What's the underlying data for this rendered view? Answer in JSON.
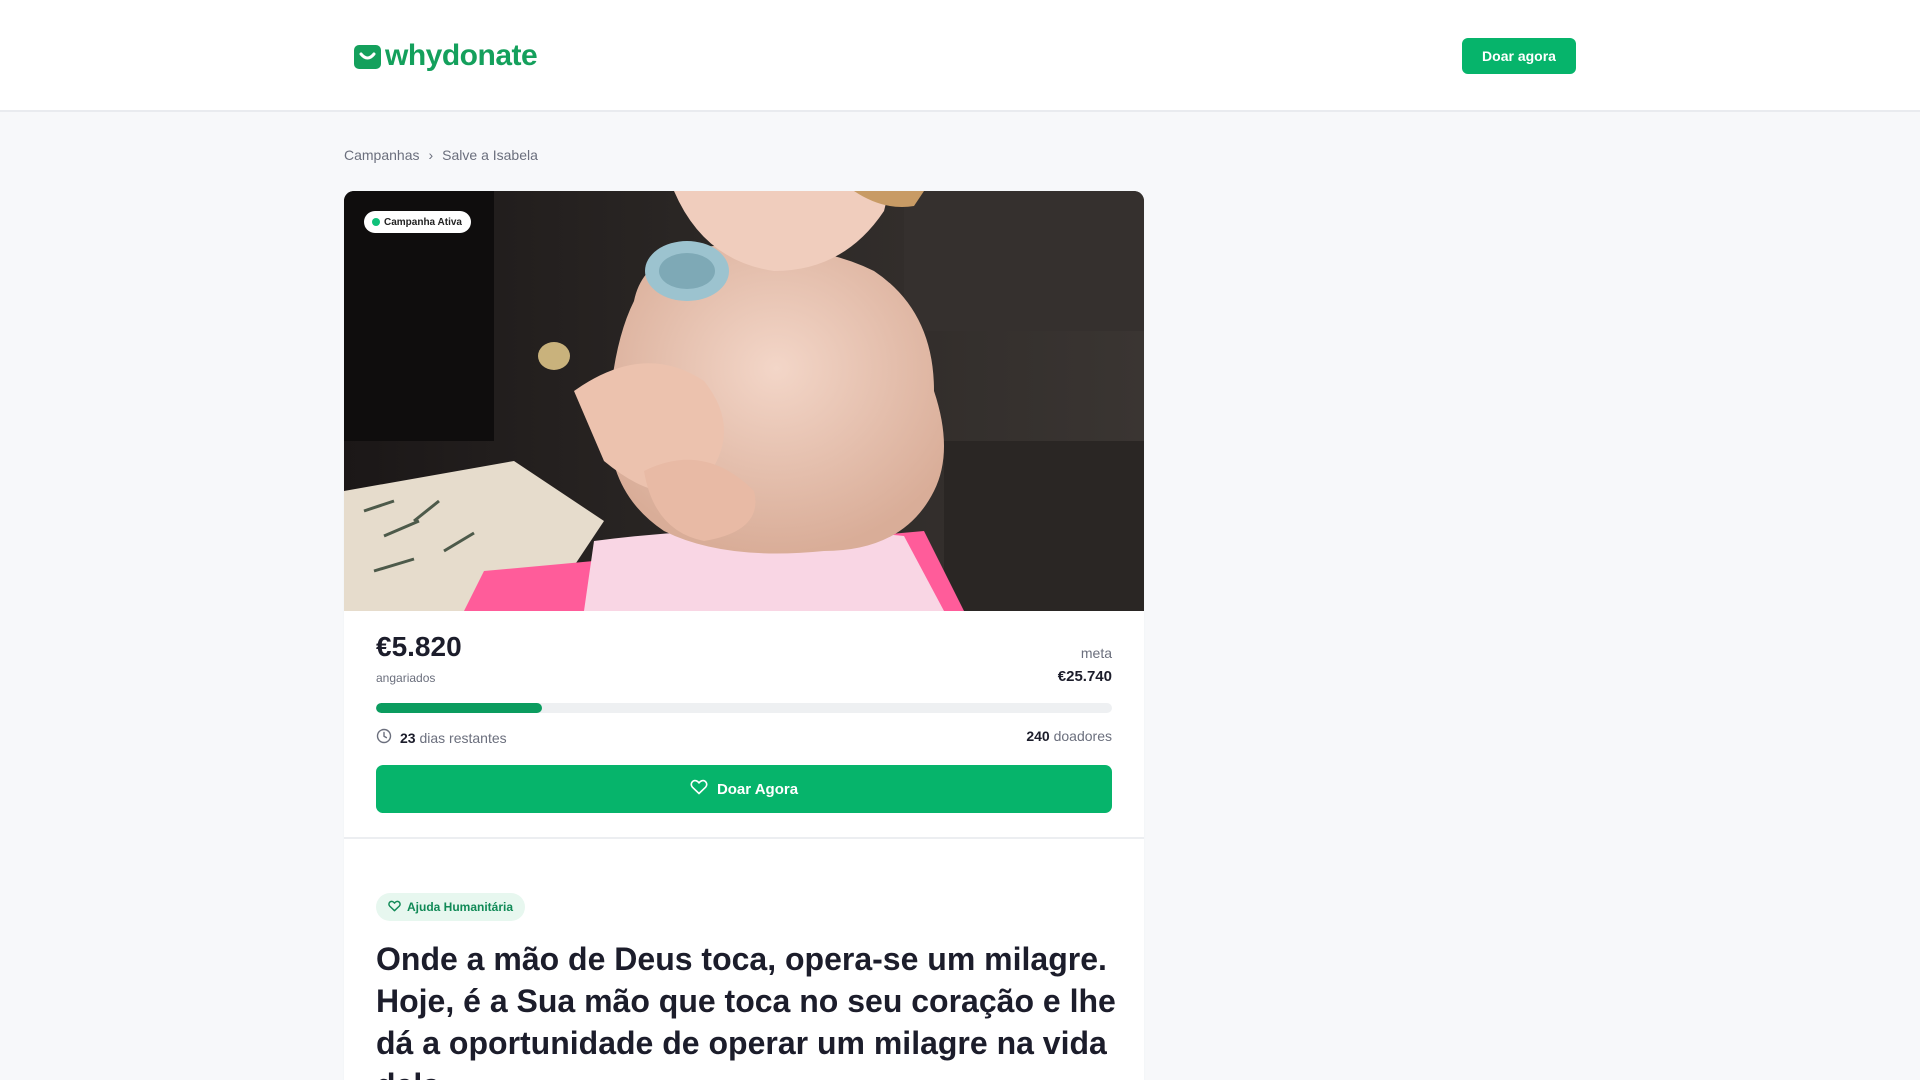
{
  "header": {
    "logo_text": "whydonate",
    "donate_button": "Doar agora"
  },
  "breadcrumb": {
    "items": [
      "Campanhas",
      "Salve a Isabela"
    ],
    "separator": "›"
  },
  "campaign": {
    "status": "Campanha Ativa",
    "raised": "€5.820",
    "raised_label": "angariados",
    "goal_label": "meta",
    "goal": "€25.740",
    "progress_fraction": 0.226,
    "days_left": "23",
    "days_label": "dias restantes",
    "donors": "240",
    "donors_label": "doadores",
    "donate_button": "Doar Agora",
    "category": "Ajuda Humanitária",
    "headline": "Onde a mão de Deus toca, opera-se um milagre. Hoje, é a Sua mão que toca no seu coração e lhe dá a oportunidade de operar um milagre na vida dela."
  },
  "icons": {
    "logo": "whydonate-logo-icon",
    "clock": "clock-icon",
    "heart": "heart-icon",
    "status": "active-dot-icon"
  },
  "colors": {
    "brand": "#06b46b",
    "brand_text": "#14a05c",
    "progress": "#0b9c5f",
    "category_bg": "#e7f7ef",
    "category_text": "#118a57",
    "text": "#1c1d2b",
    "muted": "#6b6f7d"
  }
}
